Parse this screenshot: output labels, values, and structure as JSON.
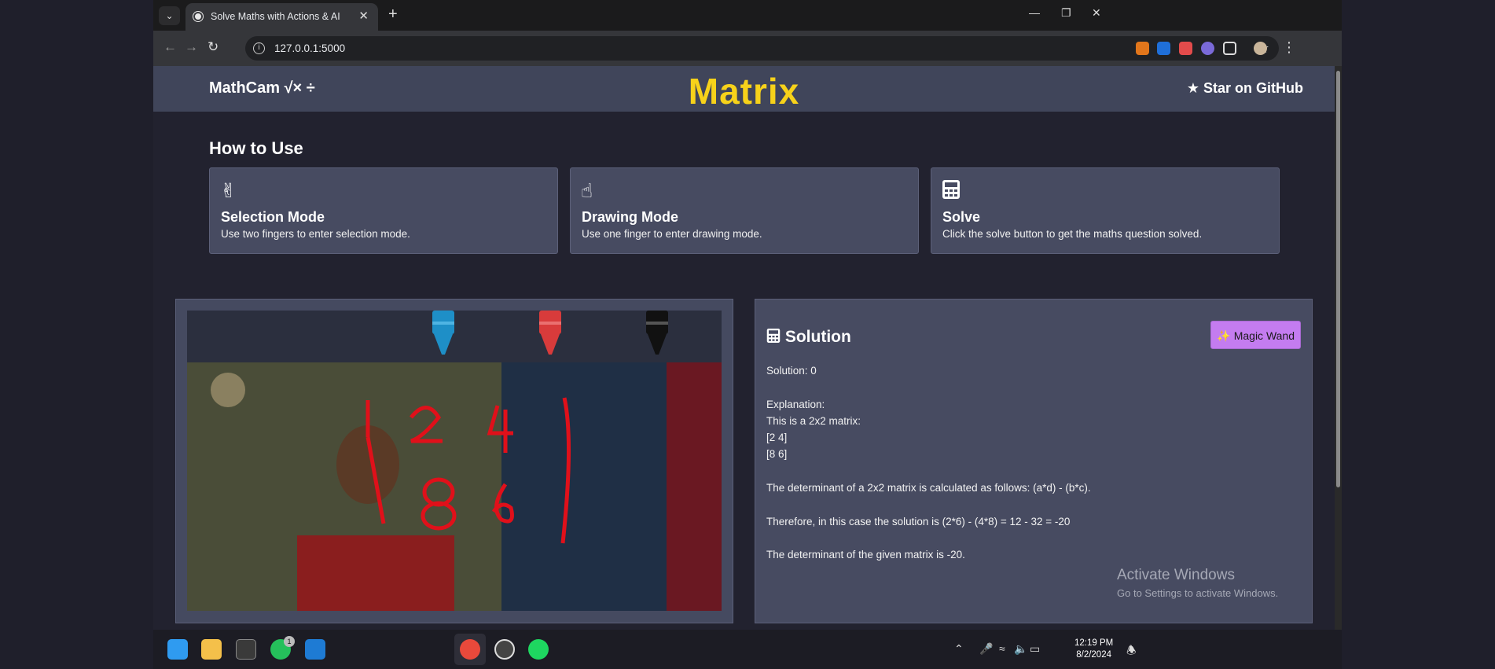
{
  "browser": {
    "tab_title": "Solve Maths with Actions & AI",
    "url": "127.0.0.1:5000"
  },
  "navbar": {
    "brand": "MathCam",
    "brand_symbols": "√× ÷",
    "title": "Matrix",
    "github_label": "Star on GitHub"
  },
  "howto": {
    "title": "How to Use",
    "cards": [
      {
        "icon": "two-fingers-hand-icon",
        "title": "Selection Mode",
        "desc": "Use two fingers to enter selection mode."
      },
      {
        "icon": "pointing-hand-icon",
        "title": "Drawing Mode",
        "desc": "Use one finger to enter drawing mode."
      },
      {
        "icon": "calculator-icon",
        "title": "Solve",
        "desc": "Click the solve button to get the maths question solved."
      }
    ]
  },
  "canvas": {
    "crayon_colors": [
      "#1e8fc7",
      "#d83b3b",
      "#111111"
    ],
    "ink_color": "#e0101a"
  },
  "solution": {
    "title": "Solution",
    "magic_label": "Magic Wand",
    "text": "Solution: 0\n\nExplanation:\nThis is a 2x2 matrix:\n[2 4]\n[8 6]\n\nThe determinant of a 2x2 matrix is calculated as follows: (a*d) - (b*c).\n\nTherefore, in this case the solution is (2*6) - (4*8) = 12 - 32 = -20\n\nThe determinant of the given matrix is -20."
  },
  "watermark": {
    "title": "Activate Windows",
    "subtitle": "Go to Settings to activate Windows."
  },
  "taskbar": {
    "whatsapp_badge": "1",
    "time": "12:19 PM",
    "date": "8/2/2024"
  },
  "colors": {
    "accent_yellow": "#f7d21a",
    "magic_purple": "#c47cf0",
    "panel": "#474b61"
  }
}
